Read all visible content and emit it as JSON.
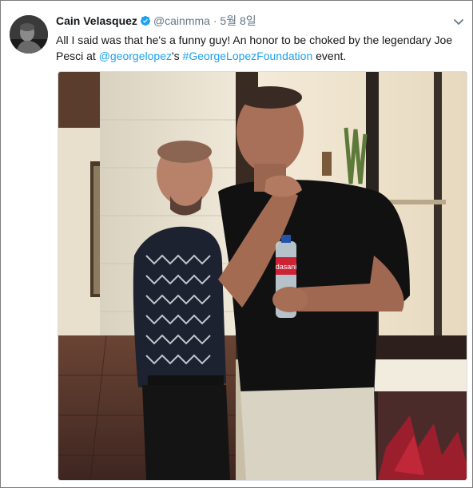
{
  "tweet": {
    "author_name": "Cain Velasquez",
    "author_handle": "@cainmma",
    "separator": "·",
    "date": "5월 8일",
    "text_part1": "All I said was that he's a funny guy! An honor to be choked by the legendary Joe Pesci at ",
    "mention": "@georgelopez",
    "text_part2": "'s ",
    "hashtag": "#GeorgeLopezFoundation",
    "text_part3": " event.",
    "photo_content": {
      "bottle_label": "dasani"
    }
  },
  "icons": {
    "verified": "verified-badge-icon",
    "caret": "chevron-down-icon"
  },
  "colors": {
    "link": "#1da1f2",
    "secondary_text": "#657786",
    "verified_badge": "#1da1f2"
  }
}
